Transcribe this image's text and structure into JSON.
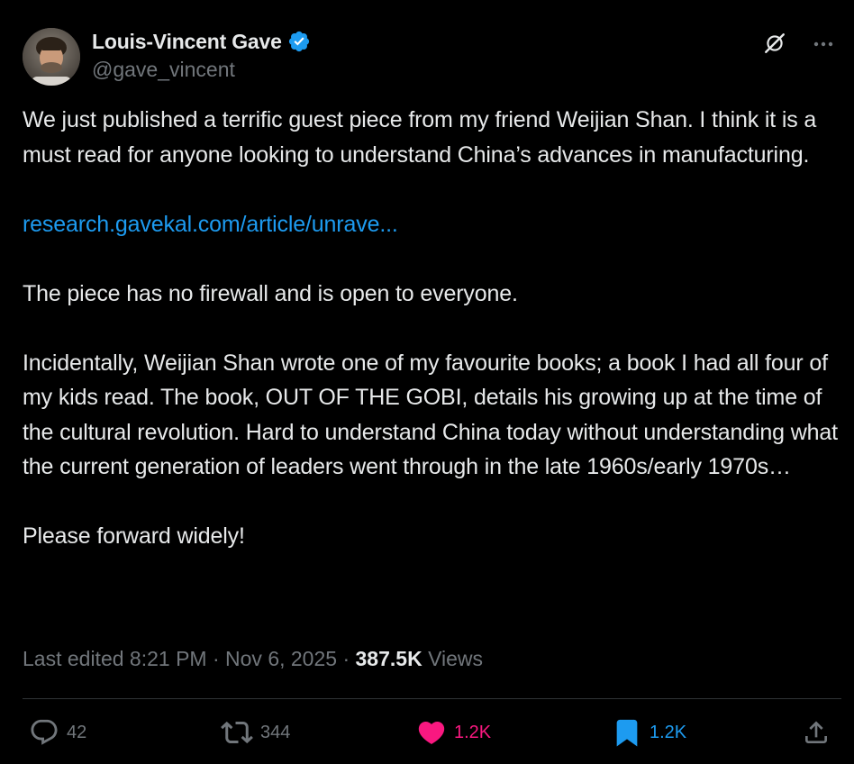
{
  "author": {
    "display_name": "Louis-Vincent Gave",
    "handle": "@gave_vincent",
    "verified": true
  },
  "tweet": {
    "paragraphs": [
      "We just published a terrific guest piece from my friend Weijian Shan. I think it is a must read for anyone looking to understand China’s advances in manufacturing.",
      "The piece has no firewall and is open to everyone.",
      "Incidentally, Weijian Shan wrote one of my favourite books; a book I had all four of my kids read. The book, OUT OF THE GOBI, details his growing up at the time of the cultural revolution. Hard to understand China today without understanding what the current generation of leaders went through in the late 1960s/early 1970s…",
      "Please forward widely!"
    ],
    "link_text": "research.gavekal.com/article/unrave..."
  },
  "meta": {
    "edited_label": "Last edited 8:21 PM",
    "separator": "·",
    "date": "Nov 6, 2025",
    "views_count": "387.5K",
    "views_label": "Views"
  },
  "actions": {
    "reply_count": "42",
    "repost_count": "344",
    "like_count": "1.2K",
    "bookmark_count": "1.2K"
  },
  "icons": {
    "verified": "verified-badge-icon",
    "grok": "grok-icon",
    "more": "more-options-icon",
    "reply": "reply-icon",
    "repost": "repost-icon",
    "like": "heart-icon",
    "bookmark": "bookmark-icon",
    "share": "share-icon"
  },
  "colors": {
    "background": "#000000",
    "text": "#e7e9ea",
    "secondary": "#71767b",
    "link": "#1d9bf0",
    "like": "#f91880",
    "bookmark": "#1d9bf0",
    "divider": "#2f3336"
  }
}
